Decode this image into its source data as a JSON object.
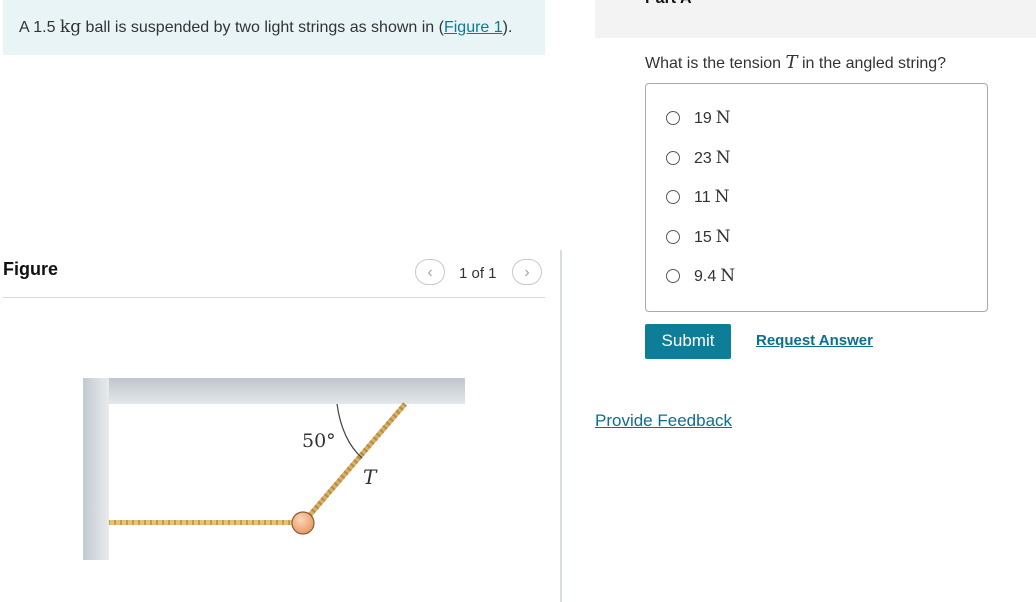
{
  "problem": {
    "text_before": "A 1.5 ",
    "unit": "kg",
    "text_middle": " ball is suspended by two light strings as shown in (",
    "link": "Figure 1",
    "text_after": ")."
  },
  "figure_panel": {
    "label": "Figure",
    "pager_text": "1 of 1",
    "prev_icon": "chevron-left",
    "next_icon": "chevron-right",
    "angle_label": "50°",
    "tension_label": "T"
  },
  "part_header": {
    "title": "Part A"
  },
  "question": {
    "text_before": "What is the tension ",
    "variable": "T",
    "text_after": " in the angled string?"
  },
  "choices": [
    {
      "value": "19",
      "unit": "N"
    },
    {
      "value": "23",
      "unit": "N"
    },
    {
      "value": "11",
      "unit": "N"
    },
    {
      "value": "15",
      "unit": "N"
    },
    {
      "value": "9.4",
      "unit": "N"
    }
  ],
  "actions": {
    "submit_label": "Submit",
    "request_label": "Request Answer",
    "feedback_label": "Provide Feedback"
  },
  "colors": {
    "accent": "#0d7d98",
    "link": "#0b6f8f",
    "problem_bg": "#e9f4f6"
  }
}
